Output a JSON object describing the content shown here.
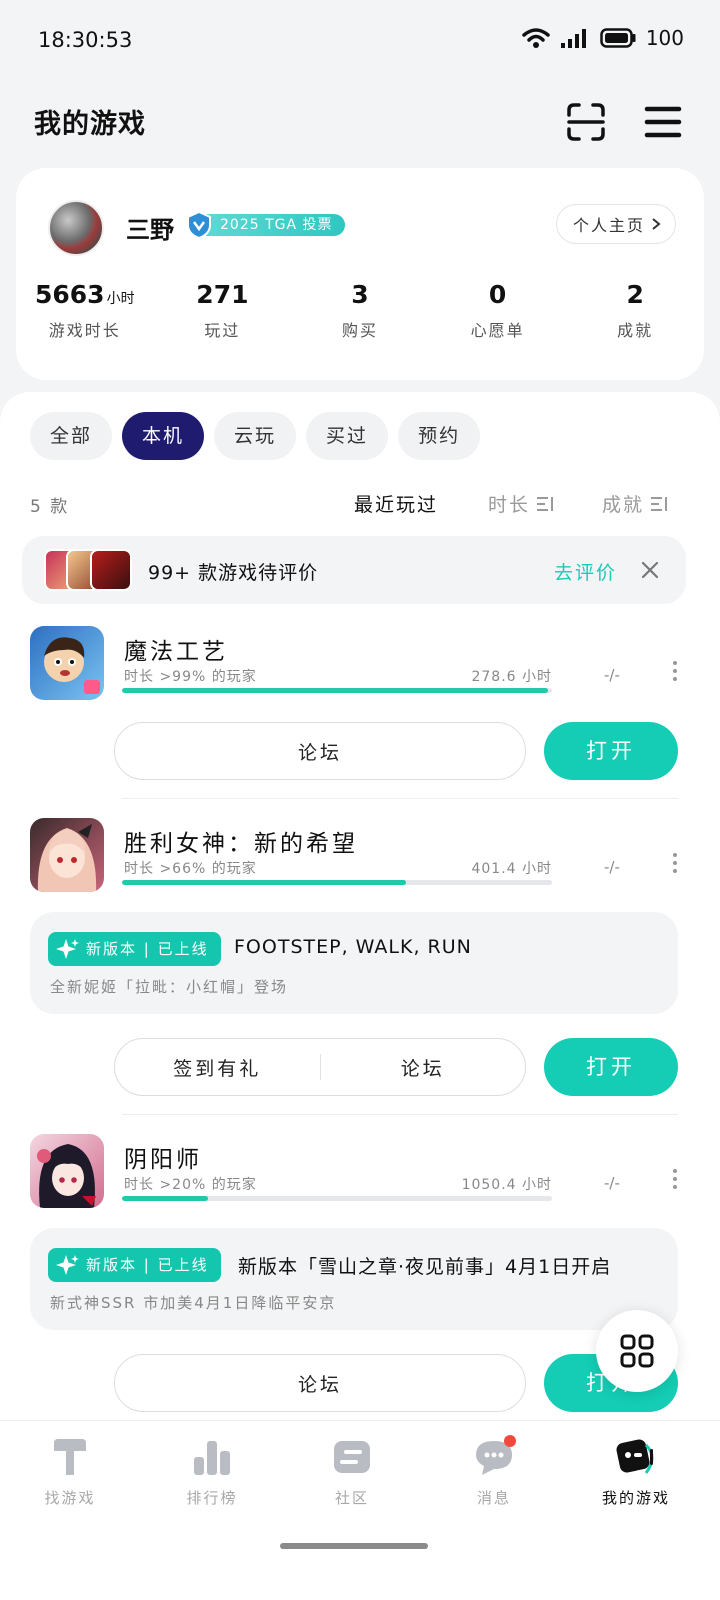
{
  "status_bar": {
    "time": "18:30:53",
    "battery": "100"
  },
  "header": {
    "title": "我的游戏"
  },
  "profile": {
    "name": "三野",
    "badge": "2025 TGA 投票",
    "home_link": "个人主页",
    "stats": [
      {
        "value": "5663",
        "unit": "小时",
        "label": "游戏时长"
      },
      {
        "value": "271",
        "unit": "",
        "label": "玩过"
      },
      {
        "value": "3",
        "unit": "",
        "label": "购买"
      },
      {
        "value": "0",
        "unit": "",
        "label": "心愿单"
      },
      {
        "value": "2",
        "unit": "",
        "label": "成就"
      }
    ]
  },
  "filters": [
    "全部",
    "本机",
    "云玩",
    "买过",
    "预约"
  ],
  "active_filter": "本机",
  "list": {
    "count": "5 款",
    "sort": {
      "recent": "最近玩过",
      "duration": "时长",
      "achievement": "成就"
    }
  },
  "review_banner": {
    "text": "99+ 款游戏待评价",
    "action": "去评价"
  },
  "games": [
    {
      "name": "魔法工艺",
      "meta": "时长 >99% 的玩家",
      "hours": "278.6 小时",
      "progress": 0.99,
      "achievement": "-/-",
      "buttons": [
        "论坛"
      ],
      "open": "打开"
    },
    {
      "name": "胜利女神：新的希望",
      "meta": "时长 >66% 的玩家",
      "hours": "401.4 小时",
      "progress": 0.66,
      "achievement": "-/-",
      "news": {
        "tag": "新版本 | 已上线",
        "title": "FOOTSTEP, WALK, RUN",
        "sub": "全新妮姬「拉毗：小红帽」登场"
      },
      "buttons": [
        "签到有礼",
        "论坛"
      ],
      "open": "打开"
    },
    {
      "name": "阴阳师",
      "meta": "时长 >20% 的玩家",
      "hours": "1050.4 小时",
      "progress": 0.2,
      "achievement": "-/-",
      "news": {
        "tag": "新版本 | 已上线",
        "title": "新版本「雪山之章·夜见前事」4月1日开启",
        "sub": "新式神SSR 市加美4月1日降临平安京"
      },
      "buttons": [
        "论坛"
      ],
      "open": "打开"
    }
  ],
  "bottom_nav": [
    {
      "label": "找游戏",
      "icon": "find-game-icon"
    },
    {
      "label": "排行榜",
      "icon": "ranking-icon"
    },
    {
      "label": "社区",
      "icon": "community-icon"
    },
    {
      "label": "消息",
      "icon": "message-icon"
    },
    {
      "label": "我的游戏",
      "icon": "my-games-icon"
    }
  ],
  "colors": {
    "accent": "#14cdb4",
    "chip_active": "#1f1b6e"
  }
}
